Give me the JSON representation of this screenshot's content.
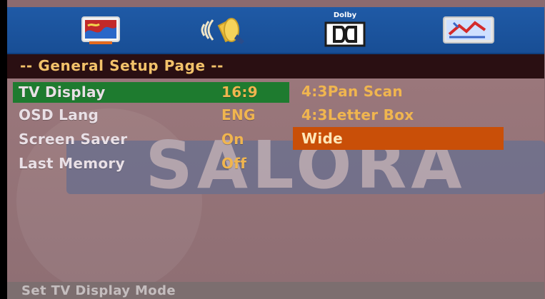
{
  "top_menu": {
    "icons": [
      {
        "name": "general-setup-icon",
        "active": true
      },
      {
        "name": "audio-setup-icon",
        "active": false
      },
      {
        "name": "dolby-setup-icon",
        "label": "Dolby",
        "active": false
      },
      {
        "name": "preference-setup-icon",
        "active": false
      }
    ]
  },
  "page": {
    "title": "-- General Setup Page --"
  },
  "menu": {
    "items": [
      {
        "label": "TV Display",
        "value": "16:9"
      },
      {
        "label": "OSD Lang",
        "value": "ENG"
      },
      {
        "label": "Screen Saver",
        "value": "On"
      },
      {
        "label": "Last Memory",
        "value": "Off"
      }
    ],
    "options": [
      {
        "label": "4:3Pan Scan"
      },
      {
        "label": "4:3Letter Box"
      },
      {
        "label": "Wide"
      }
    ]
  },
  "watermark": {
    "text": "SALORA"
  },
  "status": {
    "text": "Set TV Display Mode"
  },
  "colors": {
    "topbar": "#1f5aa6",
    "header": "#2a0f12",
    "title": "#f2c26a",
    "selected_row": "#1e7b2f",
    "selected_option": "#c94f08",
    "value_text": "#f0b54f"
  }
}
